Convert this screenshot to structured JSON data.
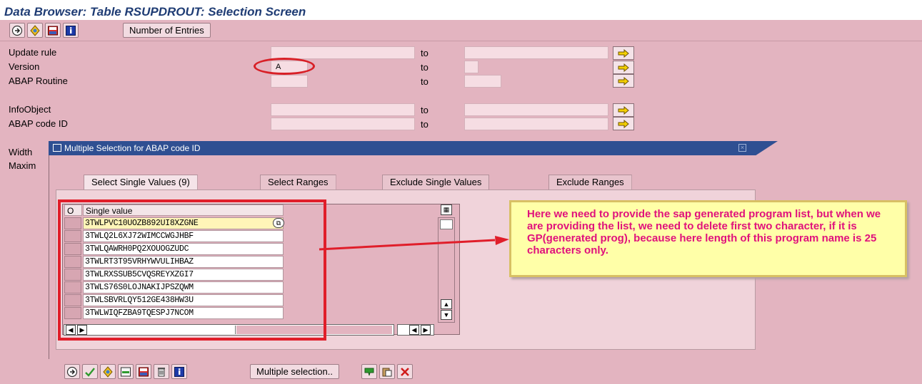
{
  "window": {
    "title": "Data Browser: Table RSUPDROUT: Selection Screen"
  },
  "toolbar": {
    "icons": [
      "execute-icon",
      "selection-options-icon",
      "save-variant-icon",
      "info-icon"
    ],
    "number_of_entries_label": "Number of Entries"
  },
  "fields": [
    {
      "label": "Update rule",
      "from_value": "",
      "to_label": "to",
      "to_value": ""
    },
    {
      "label": "Version",
      "from_value": "A",
      "to_label": "to",
      "to_value": ""
    },
    {
      "label": "ABAP Routine",
      "from_value": "",
      "to_label": "to",
      "to_value": ""
    },
    {
      "label": "InfoObject",
      "from_value": "",
      "to_label": "to",
      "to_value": ""
    },
    {
      "label": "ABAP code ID",
      "from_value": "",
      "to_label": "to",
      "to_value": ""
    }
  ],
  "hidden_labels": {
    "width": "Width",
    "maximum": "Maxim"
  },
  "dialog": {
    "title": "Multiple Selection for ABAP code ID",
    "tabs": [
      "Select Single Values (9)",
      "Select Ranges",
      "Exclude Single Values",
      "Exclude Ranges"
    ],
    "table": {
      "col_o": "O",
      "col_value": "Single value",
      "rows": [
        "3TWLPVC10UOZB892UI8XZGNE",
        "3TWLQ2L6XJ72WIMCCWGJHBF",
        "3TWLQAWRH0PQ2XOUOGZUDC",
        "3TWLRT3T95VRHYWVULIHBAZ",
        "3TWLRXSSUB5CVQSREYXZGI7",
        "3TWLS76S0LOJNAKIJPSZQWM",
        "3TWLSBVRLQY512GE438HW3U",
        "3TWLWIQFZBA9TQESPJ7NCOM"
      ]
    },
    "bottom_toolbar": {
      "multiple_selection_label": "Multiple selection.."
    }
  },
  "callout": {
    "text": "Here we need to provide the sap generated program list, but when we are providing the list, we need to delete first two character, if it is GP(generated prog), because here length of this program name is 25 characters only."
  },
  "colors": {
    "screen_bg": "#e3b4c0",
    "dialog_header": "#2f4f92",
    "annotation_red": "#e01e2a",
    "callout_text": "#e0117c",
    "callout_bg": "#ffffa8"
  }
}
